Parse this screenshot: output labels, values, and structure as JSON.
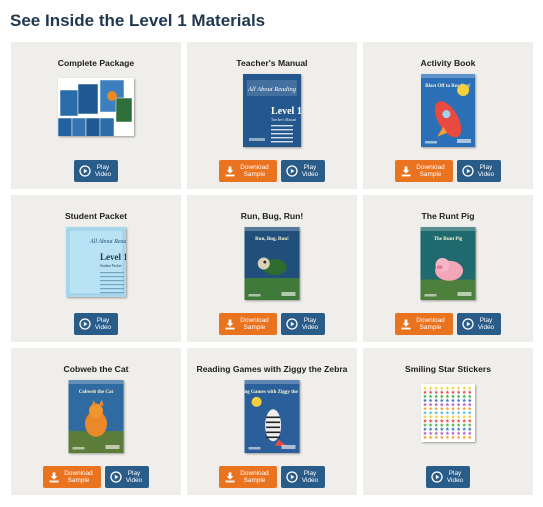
{
  "page": {
    "heading": "See Inside the Level 1 Materials"
  },
  "colors": {
    "heading": "#1f3850",
    "play_button": "#2a5c8a",
    "download_button": "#ea7320",
    "card_bg": "#efeeea"
  },
  "buttons": {
    "play_line1": "Play",
    "play_line2": "Video",
    "download_line1": "Download",
    "download_line2": "Sample",
    "play_icon": "play-circle-icon",
    "download_icon": "download-icon"
  },
  "cards": [
    {
      "title": "Complete Package",
      "has_sample": false
    },
    {
      "title": "Teacher's Manual",
      "has_sample": true,
      "cover": {
        "brand": "All About Reading",
        "level": "Level 1",
        "subtitle": "Teacher's Manual"
      }
    },
    {
      "title": "Activity Book",
      "has_sample": true,
      "cover": {
        "title": "Blast Off to Reading!"
      }
    },
    {
      "title": "Student Packet",
      "has_sample": false,
      "cover": {
        "brand": "All About Reading",
        "level": "Level 1",
        "subtitle": "Student Packet"
      }
    },
    {
      "title": "Run, Bug, Run!",
      "has_sample": true,
      "cover": {
        "title": "Run, Bug, Run!"
      }
    },
    {
      "title": "The Runt Pig",
      "has_sample": true,
      "cover": {
        "title": "The Runt Pig"
      }
    },
    {
      "title": "Cobweb the Cat",
      "has_sample": true,
      "cover": {
        "title": "Cobweb the Cat"
      }
    },
    {
      "title": "Reading Games with Ziggy the Zebra",
      "has_sample": true,
      "cover": {
        "title": "Reading Games with Ziggy the Zebra"
      }
    },
    {
      "title": "Smiling Star Stickers",
      "has_sample": false
    }
  ]
}
